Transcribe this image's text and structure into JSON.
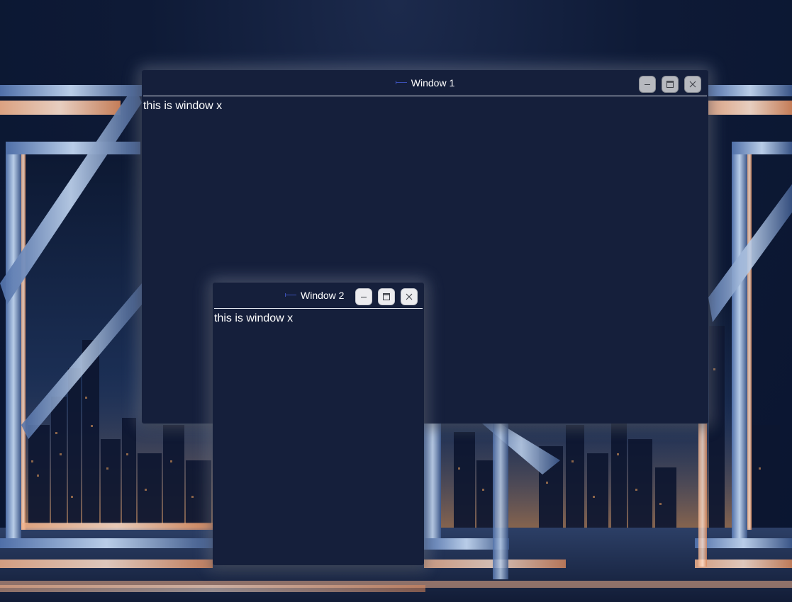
{
  "desktop": {
    "wallpaper": "city-skyline-frames-wallpaper"
  },
  "windows": [
    {
      "title": "Window 1",
      "icon": "window-app-icon",
      "body_text": "this is window x",
      "controls": {
        "minimize": "minimize-icon",
        "maximize": "maximize-icon",
        "close": "close-icon"
      },
      "button_color": "#b7b9bf"
    },
    {
      "title": "Window 2",
      "icon": "window-app-icon",
      "body_text": "this is window x",
      "controls": {
        "minimize": "minimize-icon",
        "maximize": "maximize-icon",
        "close": "close-icon"
      },
      "button_color": "#ececef"
    }
  ],
  "colors": {
    "window_background": "#151f3b",
    "title_divider": "#e2e6ee",
    "text": "#ffffff"
  }
}
